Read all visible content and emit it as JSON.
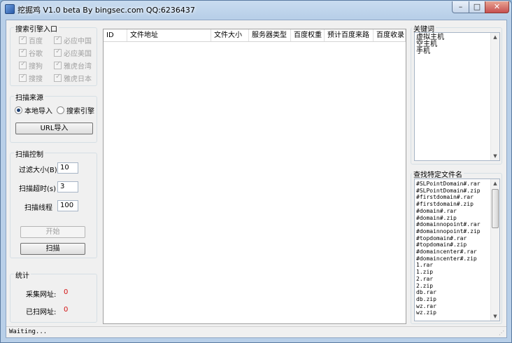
{
  "window": {
    "title": "挖掘鸡 V1.0 beta By bingsec.com QQ:6236437",
    "min": "–",
    "max": "□",
    "close": "✕"
  },
  "search_engines": {
    "title": "搜索引擎入口",
    "items": [
      "百度",
      "必应中国",
      "谷歌",
      "必应美国",
      "搜狗",
      "雅虎台湾",
      "搜搜",
      "雅虎日本"
    ]
  },
  "scan_source": {
    "title": "扫描来源",
    "local": "本地导入",
    "engine": "搜索引擎",
    "url_import": "URL导入"
  },
  "scan_control": {
    "title": "扫描控制",
    "filter_label": "过滤大小(B)",
    "filter_value": "10",
    "timeout_label": "扫描超时(s)",
    "timeout_value": "3",
    "threads_label": "扫描线程",
    "threads_value": "100",
    "start": "开始",
    "scan": "扫描"
  },
  "stats": {
    "title": "统计",
    "collected_label": "采集网址:",
    "collected_value": "0",
    "scanned_label": "已扫网址:",
    "scanned_value": "0"
  },
  "results": {
    "columns": [
      "ID",
      "文件地址",
      "文件大小",
      "服务器类型",
      "百度权重",
      "预计百度来路",
      "百度收录"
    ]
  },
  "keywords": {
    "title": "关键词",
    "lines": [
      "虚拟主机",
      "空主机",
      "手机"
    ]
  },
  "file_names": {
    "title": "查找特定文件名",
    "lines": [
      "#SLPointDomain#.rar",
      "#SLPointDomain#.zip",
      "#firstdomain#.rar",
      "#firstdomain#.zip",
      "#domain#.rar",
      "#domain#.zip",
      "#domainnopoint#.rar",
      "#domainnopoint#.zip",
      "#topdomain#.rar",
      "#topdomain#.zip",
      "#domaincenter#.rar",
      "#domaincenter#.zip",
      "1.rar",
      "1.zip",
      "2.rar",
      "2.zip",
      "db.rar",
      "db.zip",
      "wz.rar",
      "wz.zip"
    ]
  },
  "status": {
    "text": "Waiting..."
  }
}
